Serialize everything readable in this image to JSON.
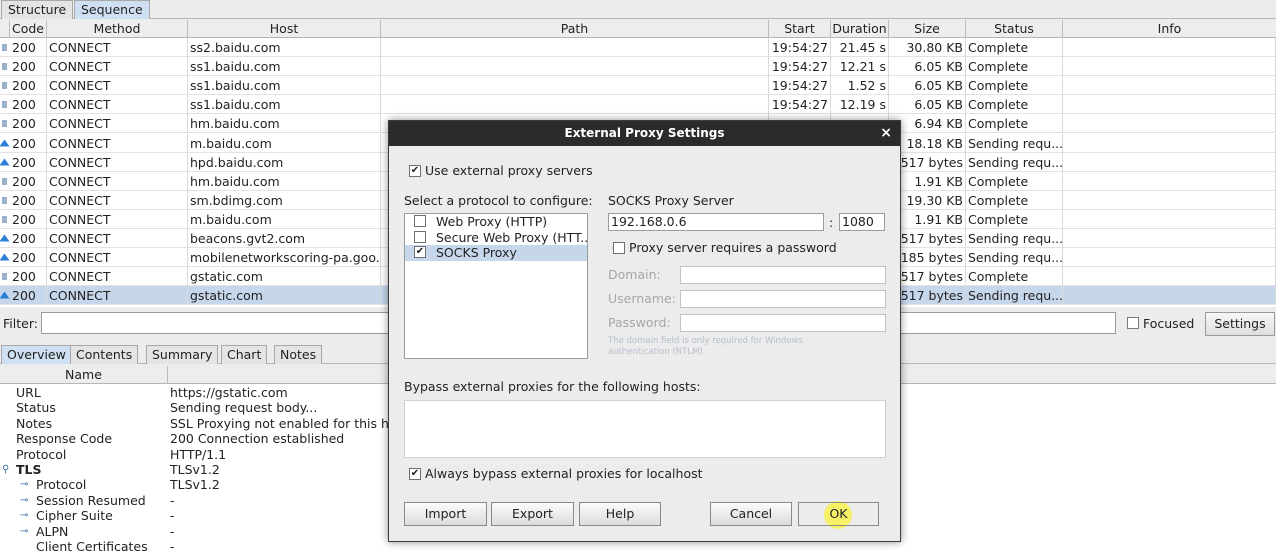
{
  "top_tabs": [
    "Structure",
    "Sequence"
  ],
  "columns": [
    "Code",
    "Method",
    "Host",
    "Path",
    "Start",
    "Duration",
    "Size",
    "Status",
    "Info"
  ],
  "rows": [
    {
      "icon": "dot",
      "code": "200",
      "method": "CONNECT",
      "host": "ss2.baidu.com",
      "path": "",
      "start": "19:54:27",
      "duration": "21.45 s",
      "size": "30.80 KB",
      "status": "Complete",
      "info": ""
    },
    {
      "icon": "dot",
      "code": "200",
      "method": "CONNECT",
      "host": "ss1.baidu.com",
      "path": "",
      "start": "19:54:27",
      "duration": "12.21 s",
      "size": "6.05 KB",
      "status": "Complete",
      "info": ""
    },
    {
      "icon": "dot",
      "code": "200",
      "method": "CONNECT",
      "host": "ss1.baidu.com",
      "path": "",
      "start": "19:54:27",
      "duration": "1.52 s",
      "size": "6.05 KB",
      "status": "Complete",
      "info": ""
    },
    {
      "icon": "dot",
      "code": "200",
      "method": "CONNECT",
      "host": "ss1.baidu.com",
      "path": "",
      "start": "19:54:27",
      "duration": "12.19 s",
      "size": "6.05 KB",
      "status": "Complete",
      "info": ""
    },
    {
      "icon": "dot",
      "code": "200",
      "method": "CONNECT",
      "host": "hm.baidu.com",
      "path": "",
      "start": "",
      "duration": "",
      "size": "6.94 KB",
      "status": "Complete",
      "info": ""
    },
    {
      "icon": "arrow",
      "code": "200",
      "method": "CONNECT",
      "host": "m.baidu.com",
      "path": "",
      "start": "",
      "duration": "",
      "size": "18.18 KB",
      "status": "Sending requ...",
      "info": ""
    },
    {
      "icon": "arrow",
      "code": "200",
      "method": "CONNECT",
      "host": "hpd.baidu.com",
      "path": "",
      "start": "",
      "duration": "",
      "size": "517 bytes",
      "status": "Sending requ...",
      "info": ""
    },
    {
      "icon": "dot",
      "code": "200",
      "method": "CONNECT",
      "host": "hm.baidu.com",
      "path": "",
      "start": "",
      "duration": "",
      "size": "1.91 KB",
      "status": "Complete",
      "info": ""
    },
    {
      "icon": "dot",
      "code": "200",
      "method": "CONNECT",
      "host": "sm.bdimg.com",
      "path": "",
      "start": "",
      "duration": "",
      "size": "19.30 KB",
      "status": "Complete",
      "info": ""
    },
    {
      "icon": "dot",
      "code": "200",
      "method": "CONNECT",
      "host": "m.baidu.com",
      "path": "",
      "start": "",
      "duration": "",
      "size": "1.91 KB",
      "status": "Complete",
      "info": ""
    },
    {
      "icon": "arrow",
      "code": "200",
      "method": "CONNECT",
      "host": "beacons.gvt2.com",
      "path": "",
      "start": "",
      "duration": "",
      "size": "517 bytes",
      "status": "Sending requ...",
      "info": ""
    },
    {
      "icon": "arrow",
      "code": "200",
      "method": "CONNECT",
      "host": "mobilenetworkscoring-pa.goo...",
      "path": "",
      "start": "",
      "duration": "",
      "size": "185 bytes",
      "status": "Sending requ...",
      "info": ""
    },
    {
      "icon": "dot",
      "code": "200",
      "method": "CONNECT",
      "host": "gstatic.com",
      "path": "",
      "start": "",
      "duration": "",
      "size": "517 bytes",
      "status": "Complete",
      "info": ""
    },
    {
      "icon": "arrow",
      "code": "200",
      "method": "CONNECT",
      "host": "gstatic.com",
      "path": "",
      "start": "",
      "duration": "",
      "size": "517 bytes",
      "status": "Sending requ...",
      "info": "",
      "selected": true
    }
  ],
  "filter": {
    "label": "Filter:",
    "value": "",
    "focused_label": "Focused",
    "focused_checked": false,
    "settings_label": "Settings"
  },
  "bottom_tabs": [
    "Overview",
    "Contents",
    "Summary",
    "Chart",
    "Notes"
  ],
  "detail": {
    "name_header": "Name",
    "rows": [
      {
        "name": "URL",
        "value": "https://gstatic.com",
        "indent": 0
      },
      {
        "name": "Status",
        "value": "Sending request body...",
        "indent": 0
      },
      {
        "name": "Notes",
        "value": "SSL Proxying not enabled for this ho",
        "indent": 0
      },
      {
        "name": "Response Code",
        "value": "200 Connection established",
        "indent": 0
      },
      {
        "name": "Protocol",
        "value": "HTTP/1.1",
        "indent": 0
      },
      {
        "name": "TLS",
        "value": "TLSv1.2",
        "indent": 0,
        "bold": true,
        "toggle": true
      },
      {
        "name": "Protocol",
        "value": "TLSv1.2",
        "indent": 1,
        "toggle": true
      },
      {
        "name": "Session Resumed",
        "value": "-",
        "indent": 1,
        "toggle": true
      },
      {
        "name": "Cipher Suite",
        "value": "-",
        "indent": 1,
        "toggle": true
      },
      {
        "name": "ALPN",
        "value": "-",
        "indent": 1,
        "toggle": true
      },
      {
        "name": "Client Certificates",
        "value": "-",
        "indent": 1
      }
    ]
  },
  "dialog": {
    "title": "External Proxy Settings",
    "close": "×",
    "use_external": {
      "label": "Use external proxy servers",
      "checked": true
    },
    "select_label": "Select a protocol to configure:",
    "protocols": [
      {
        "label": "Web Proxy (HTTP)",
        "checked": false,
        "selected": false
      },
      {
        "label": "Secure Web Proxy (HTT...",
        "checked": false,
        "selected": false
      },
      {
        "label": "SOCKS Proxy",
        "checked": true,
        "selected": true
      }
    ],
    "server_label": "SOCKS Proxy Server",
    "host": "192.168.0.6",
    "port_sep": ":",
    "port": "1080",
    "requires_password": {
      "label": "Proxy server requires a password",
      "checked": false
    },
    "domain_label": "Domain:",
    "username_label": "Username:",
    "password_label": "Password:",
    "hint": "The domain field is only required for Windows authentication (NTLM).",
    "bypass_label": "Bypass external proxies for the following hosts:",
    "bypass_value": "",
    "always_bypass": {
      "label": "Always bypass external proxies for localhost",
      "checked": true
    },
    "buttons": {
      "import": "Import",
      "export": "Export",
      "help": "Help",
      "cancel": "Cancel",
      "ok": "OK"
    }
  }
}
